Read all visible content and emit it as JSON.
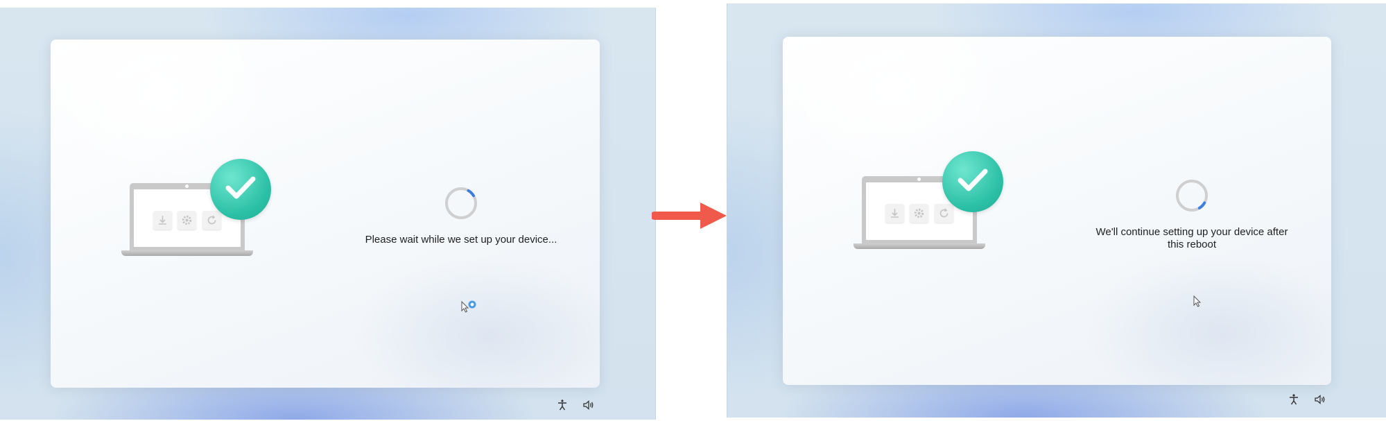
{
  "panels": [
    {
      "status_text": "Please wait while we set up your device...",
      "spinner_progress": 0.08
    },
    {
      "status_text": "We'll continue setting up your device after this reboot",
      "spinner_progress": 0.08
    }
  ],
  "icons": {
    "checkmark": "checkmark-icon",
    "download": "download-icon",
    "settings": "gear-icon",
    "refresh": "refresh-icon",
    "accessibility": "accessibility-icon",
    "volume": "volume-icon",
    "cursor": "pointer-cursor-icon",
    "transition": "arrow-right-icon"
  },
  "colors": {
    "accent": "#2bc0a6",
    "spinner_accent": "#3b7de0",
    "arrow": "#f05a4a"
  }
}
